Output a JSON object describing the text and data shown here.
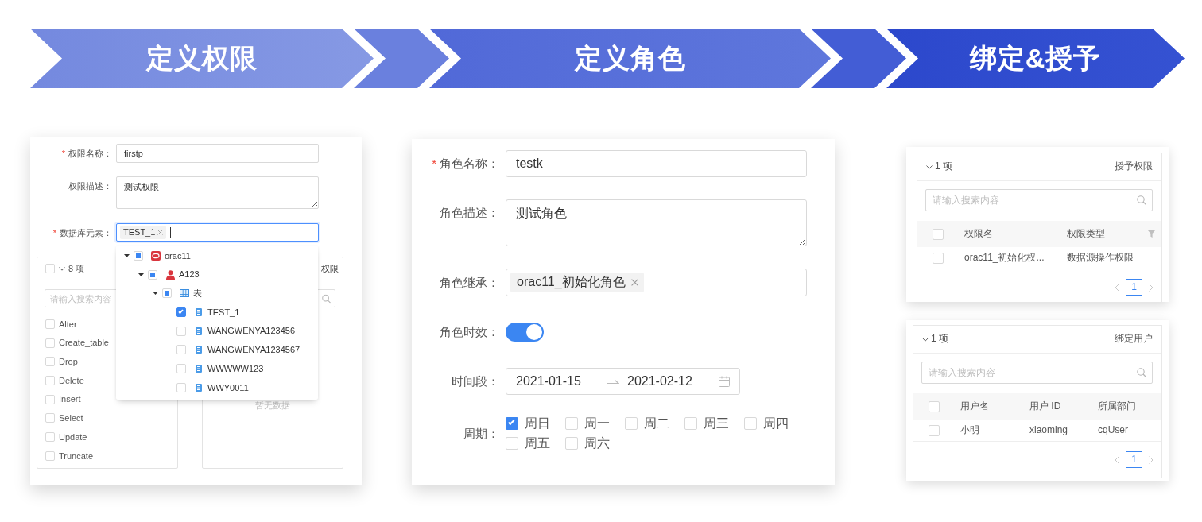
{
  "steps": [
    {
      "title": "定义权限"
    },
    {
      "title": "定义角色"
    },
    {
      "title": "绑定&授予"
    }
  ],
  "permission_form": {
    "fields": [
      {
        "kind": "input",
        "required_mark": "*",
        "label": "权限名称：",
        "value": "firstp"
      },
      {
        "kind": "textarea",
        "label": "权限描述：",
        "value": "测试权限"
      },
      {
        "kind": "tags",
        "required_mark": "*",
        "label": "数据库元素：",
        "tags": [
          "TEST_1"
        ],
        "focused": true,
        "open": true,
        "tree": [
          {
            "kind": "datasource",
            "label": "orac11",
            "expanded": true,
            "indeterminate": true,
            "children": [
              {
                "kind": "schema",
                "label": "A123",
                "expanded": true,
                "indeterminate": true,
                "children": [
                  {
                    "kind": "category",
                    "label": "表",
                    "expanded": true,
                    "indeterminate": true,
                    "children": [
                      {
                        "kind": "table",
                        "label": "TEST_1",
                        "checked": true
                      },
                      {
                        "kind": "table",
                        "label": "WANGWENYA123456",
                        "checked": false
                      },
                      {
                        "kind": "table",
                        "label": "WANGWENYA1234567",
                        "checked": false
                      },
                      {
                        "kind": "table",
                        "label": "WWWWW123",
                        "checked": false
                      },
                      {
                        "kind": "table",
                        "label": "WWY0011",
                        "checked": false
                      }
                    ]
                  }
                ]
              }
            ]
          }
        ]
      }
    ],
    "transfer": {
      "source": {
        "select_all": {
          "checked": false
        },
        "count": "8 项",
        "search_placeholder": "请输入搜索内容",
        "items": [
          {
            "label": "Alter",
            "checked": false
          },
          {
            "label": "Create_table",
            "checked": false
          },
          {
            "label": "Drop",
            "checked": false
          },
          {
            "label": "Delete",
            "checked": false
          },
          {
            "label": "Insert",
            "checked": false
          },
          {
            "label": "Select",
            "checked": false
          },
          {
            "label": "Update",
            "checked": false
          },
          {
            "label": "Truncate",
            "checked": false
          }
        ]
      },
      "target": {
        "title": "权限",
        "empty_text": "暂无数据"
      }
    }
  },
  "role_form": {
    "fields": [
      {
        "kind": "input",
        "required_mark": "*",
        "label": "角色名称：",
        "value": "testk"
      },
      {
        "kind": "textarea",
        "label": "角色描述：",
        "value": "测试角色"
      },
      {
        "kind": "tags",
        "label": "角色继承：",
        "tags": [
          "orac11_初始化角色"
        ]
      },
      {
        "kind": "switch",
        "label": "角色时效：",
        "on": true
      },
      {
        "kind": "date_range",
        "label": "时间段：",
        "start": "2021-01-15",
        "end": "2021-02-12"
      },
      {
        "kind": "checkbox_group",
        "label": "周期：",
        "options": [
          {
            "label": "周日",
            "checked": true
          },
          {
            "label": "周一",
            "checked": false
          },
          {
            "label": "周二",
            "checked": false
          },
          {
            "label": "周三",
            "checked": false
          },
          {
            "label": "周四",
            "checked": false
          },
          {
            "label": "周五",
            "checked": false
          },
          {
            "label": "周六",
            "checked": false
          }
        ]
      }
    ]
  },
  "grant_panel": {
    "count": "1 项",
    "title": "授予权限",
    "search_placeholder": "请输入搜索内容",
    "table": {
      "header_checked": false,
      "columns": [
        {
          "label": "权限名"
        },
        {
          "label": "权限类型",
          "filterable": true
        }
      ],
      "rows": [
        {
          "checked": false,
          "cells": [
            "orac11_初始化权...",
            "数据源操作权限"
          ]
        }
      ]
    },
    "pages": [
      {
        "label": "1",
        "selected": true
      }
    ]
  },
  "bind_panel": {
    "count": "1 项",
    "title": "绑定用户",
    "search_placeholder": "请输入搜索内容",
    "table": {
      "header_checked": false,
      "columns": [
        {
          "label": "用户名"
        },
        {
          "label": "用户 ID"
        },
        {
          "label": "所属部门"
        }
      ],
      "rows": [
        {
          "checked": false,
          "cells": [
            "小明",
            "xiaoming",
            "cqUser"
          ]
        }
      ]
    },
    "pages": [
      {
        "label": "1",
        "selected": true
      }
    ]
  }
}
